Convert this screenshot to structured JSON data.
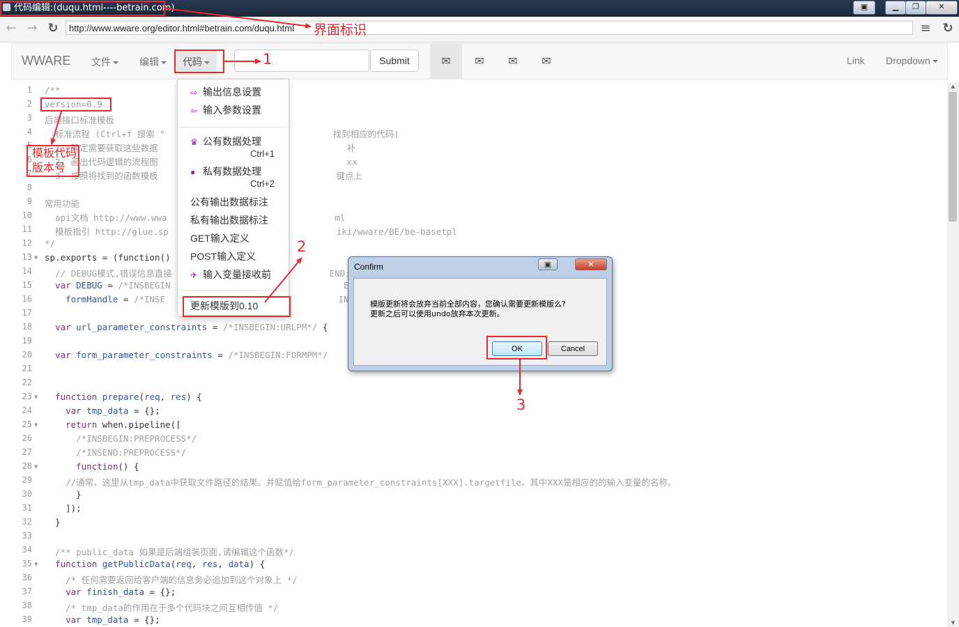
{
  "window": {
    "title": "代码编辑:(duqu.html----betrain.com)"
  },
  "browser": {
    "url": "http://www.wware.org/editor.html#betrain.com/duqu.html"
  },
  "navbar": {
    "brand": "WWARE",
    "menus": [
      "文件",
      "编辑",
      "代码"
    ],
    "submit_label": "Submit",
    "search_value": "",
    "right_links": [
      "Link",
      "Dropdown"
    ]
  },
  "code_menu": {
    "items": [
      {
        "label": "输出信息设置",
        "icon": "export-icon"
      },
      {
        "label": "输入参数设置",
        "icon": "import-icon"
      },
      {
        "label": "公有数据处理",
        "icon": "queen-icon",
        "shortcut": "Ctrl+1"
      },
      {
        "label": "私有数据处理",
        "icon": "user-icon",
        "shortcut": "Ctrl+2"
      },
      {
        "label": "公有输出数据标注"
      },
      {
        "label": "私有输出数据标注"
      },
      {
        "label": "GET输入定义"
      },
      {
        "label": "POST输入定义"
      },
      {
        "label": "输入变量接收前",
        "icon": "plane-icon"
      },
      {
        "label": "更新模版到0.10"
      }
    ]
  },
  "editor": {
    "lines": [
      {
        "n": "1",
        "t": [
          [
            "c",
            "/**"
          ]
        ]
      },
      {
        "n": "2",
        "t": [
          [
            "c",
            "version=0.9"
          ]
        ]
      },
      {
        "n": "3",
        "t": [
          [
            "c",
            "后端接口标准模板"
          ]
        ]
      },
      {
        "n": "4",
        "t": [
          [
            "c",
            "  标准流程 (Ctrl+f 搜索 \""
          ],
          [
            "g",
            "                                "
          ],
          [
            "c",
            "找到相应的代码)"
          ]
        ]
      },
      {
        "n": "5",
        "t": [
          [
            "c",
            "  1. 确定需要获取这些数据"
          ],
          [
            "g",
            "                                    "
          ],
          [
            "c",
            "补"
          ]
        ]
      },
      {
        "n": "6",
        "t": [
          [
            "c",
            "  2. 画出代码逻辑的流程图"
          ],
          [
            "g",
            "                                    "
          ],
          [
            "c",
            "xx"
          ]
        ]
      },
      {
        "n": "7",
        "t": [
          [
            "c",
            "  3. 按照将找到的函数模板"
          ],
          [
            "g",
            "                                  "
          ],
          [
            "c",
            "键点上"
          ]
        ]
      },
      {
        "n": "8",
        "t": []
      },
      {
        "n": "9",
        "t": [
          [
            "c",
            "常用功能"
          ]
        ]
      },
      {
        "n": "10",
        "t": [
          [
            "c",
            "  api文档 http://www.wwa"
          ],
          [
            "g",
            "                                "
          ],
          [
            "c",
            "ml"
          ]
        ]
      },
      {
        "n": "11",
        "t": [
          [
            "c",
            "  模板指引 http://glue.sp"
          ],
          [
            "g",
            "                                "
          ],
          [
            "c",
            "iki/wware/BE/be-basetpl"
          ]
        ]
      },
      {
        "n": "12",
        "t": [
          [
            "c",
            "*/"
          ]
        ]
      },
      {
        "n": "13",
        "f": true,
        "t": [
          [
            "p",
            "sp.exports = (function()"
          ]
        ]
      },
      {
        "n": "14",
        "t": [
          [
            "c",
            "  // DEBUG模式,错误信息直接"
          ],
          [
            "g",
            "                              "
          ],
          [
            "c",
            "END:DEBUG*/"
          ]
        ]
      },
      {
        "n": "15",
        "t": [
          [
            "k",
            "  var "
          ],
          [
            "v",
            "DEBUG"
          ],
          [
            "p",
            " = "
          ],
          [
            "c",
            "/*INSBEGIN"
          ],
          [
            "g",
            "                                 "
          ],
          [
            "c",
            "END:DEBUG*/"
          ]
        ]
      },
      {
        "n": "16",
        "t": [
          [
            "v",
            "    formHandle"
          ],
          [
            "p",
            " = "
          ],
          [
            "c",
            "/*INSE"
          ],
          [
            "g",
            "                                 "
          ],
          [
            "c",
            "INSEND:FORM"
          ]
        ]
      },
      {
        "n": "17",
        "t": []
      },
      {
        "n": "18",
        "t": [
          [
            "k",
            "  var "
          ],
          [
            "v",
            "url_parameter_constraints"
          ],
          [
            "p",
            " = "
          ],
          [
            "c",
            "/*INSBEGIN:URLPM*/"
          ],
          [
            "p",
            " {"
          ]
        ]
      },
      {
        "n": "19",
        "t": []
      },
      {
        "n": "20",
        "t": [
          [
            "k",
            "  var "
          ],
          [
            "v",
            "form_parameter_constraints"
          ],
          [
            "p",
            " = "
          ],
          [
            "c",
            "/*INSBEGIN:FORMPM*/"
          ]
        ]
      },
      {
        "n": "21",
        "t": []
      },
      {
        "n": "22",
        "t": []
      },
      {
        "n": "23",
        "f": true,
        "t": [
          [
            "k",
            "  function "
          ],
          [
            "v",
            "prepare"
          ],
          [
            "p",
            "("
          ],
          [
            "v",
            "req"
          ],
          [
            "p",
            ", "
          ],
          [
            "v",
            "res"
          ],
          [
            "p",
            ") {"
          ]
        ]
      },
      {
        "n": "24",
        "t": [
          [
            "k",
            "    var "
          ],
          [
            "v",
            "tmp_data"
          ],
          [
            "p",
            " = {};"
          ]
        ]
      },
      {
        "n": "25",
        "f": true,
        "t": [
          [
            "k",
            "    return "
          ],
          [
            "p",
            "when.pipeline(["
          ]
        ]
      },
      {
        "n": "26",
        "t": [
          [
            "c",
            "      /*INSBEGIN:PREPROCESS*/"
          ]
        ]
      },
      {
        "n": "27",
        "t": [
          [
            "c",
            "      /*INSEND:PREPROCESS*/"
          ]
        ]
      },
      {
        "n": "28",
        "f": true,
        "t": [
          [
            "k",
            "      function"
          ],
          [
            "p",
            "() {"
          ]
        ]
      },
      {
        "n": "29",
        "t": [
          [
            "c",
            "    //通常，这里从tmp_data中获取文件路径的结果。并赋值给form_parameter_constraints[XXX].targetfile。其中XXX是相应的的输入变量的名称。"
          ]
        ]
      },
      {
        "n": "30",
        "t": [
          [
            "p",
            "      }"
          ]
        ]
      },
      {
        "n": "31",
        "t": [
          [
            "p",
            "    ]);"
          ]
        ]
      },
      {
        "n": "32",
        "t": [
          [
            "p",
            "  }"
          ]
        ]
      },
      {
        "n": "33",
        "t": []
      },
      {
        "n": "34",
        "t": [
          [
            "c",
            "  /** public_data 如果是后端组装页面,请编辑这个函数*/"
          ]
        ]
      },
      {
        "n": "35",
        "f": true,
        "t": [
          [
            "k",
            "  function "
          ],
          [
            "v",
            "getPublicData"
          ],
          [
            "p",
            "("
          ],
          [
            "v",
            "req"
          ],
          [
            "p",
            ", "
          ],
          [
            "v",
            "res"
          ],
          [
            "p",
            ", "
          ],
          [
            "v",
            "data"
          ],
          [
            "p",
            ") {"
          ]
        ]
      },
      {
        "n": "36",
        "t": [
          [
            "c",
            "    /* 任何需要返回给客户端的信息务必追加到这个对象上 */"
          ]
        ]
      },
      {
        "n": "37",
        "t": [
          [
            "k",
            "    var "
          ],
          [
            "v",
            "finish_data"
          ],
          [
            "p",
            " = {};"
          ]
        ]
      },
      {
        "n": "38",
        "t": [
          [
            "c",
            "    /* tmp_data的作用在于多个代码块之间互相传值 */"
          ]
        ]
      },
      {
        "n": "39",
        "t": [
          [
            "k",
            "    var "
          ],
          [
            "v",
            "tmp_data"
          ],
          [
            "p",
            " = {};"
          ]
        ]
      }
    ]
  },
  "dialog": {
    "title": "Confirm",
    "message_line1": "模版更新将会放弃当前全部内容，您确认需要更新模版么?",
    "message_line2": "更新之后可以使用undo放弃本次更新。",
    "ok_label": "OK",
    "cancel_label": "Cancel"
  },
  "annotations": {
    "ui_label": "界面标识",
    "step1": "1",
    "step2": "2",
    "step3": "3",
    "version_note_line1": "模板代码",
    "version_note_line2": "版本号"
  },
  "colors": {
    "annotation": "#e8292c",
    "menu_icon": "#a020a0"
  }
}
